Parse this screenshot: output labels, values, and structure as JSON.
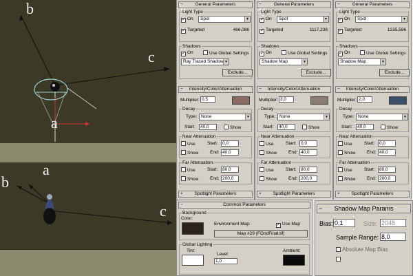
{
  "viewport_top": {
    "label_b": "b",
    "label_c": "c",
    "label_a": "a"
  },
  "viewport_bottom": {
    "label_a": "a",
    "label_b": "b",
    "label_c": "c"
  },
  "panels": [
    {
      "letter": "a",
      "general_title": "General Parameters",
      "light_type_title": "Light Type",
      "on_label": "On",
      "light_type_value": "Spot",
      "targeted_label": "Targeted",
      "target_distance": "466,086",
      "shadows_title": "Shadows",
      "use_global_label": "Use Global Settings",
      "shadow_type": "Ray Traced Shadows",
      "exclude_label": "Exclude...",
      "ica_title": "Intensity/Color/Attenuation",
      "multiplier_label": "Multiplier:",
      "multiplier": "0,5",
      "color": "#8b6b62",
      "decay_title": "Decay",
      "type_label": "Type:",
      "decay_type": "None",
      "start_label": "Start:",
      "decay_start": "40,0",
      "show_label": "Show",
      "near_title": "Near Attenuation",
      "use_label": "Use",
      "near_start": "0,0",
      "end_label": "End:",
      "near_end": "40,0",
      "far_title": "Far Attenuation",
      "far_start": "80,0",
      "far_end": "200,0",
      "spotlight_title": "Spotlight Parameters"
    },
    {
      "letter": "b",
      "general_title": "General Parameters",
      "light_type_title": "Light Type",
      "on_label": "On",
      "light_type_value": "Spot",
      "targeted_label": "Targeted",
      "target_distance": "1117,238",
      "shadows_title": "Shadows",
      "use_global_label": "Use Global Settings",
      "shadow_type": "Shadow Map",
      "exclude_label": "Exclude...",
      "ica_title": "Intensity/Color/Attenuation",
      "multiplier_label": "Multiplier:",
      "multiplier": "3,0",
      "color": "#8b7c70",
      "decay_title": "Decay",
      "type_label": "Type:",
      "decay_type": "None",
      "start_label": "Start:",
      "decay_start": "40,0",
      "show_label": "Show",
      "near_title": "Near Attenuation",
      "use_label": "Use",
      "near_start": "0,0",
      "end_label": "End:",
      "near_end": "40,0",
      "far_title": "Far Attenuation",
      "far_start": "80,0",
      "far_end": "200,0",
      "spotlight_title": "Spotlight Parameters"
    },
    {
      "letter": "c",
      "general_title": "General Parameters",
      "light_type_title": "Light Type",
      "on_label": "On",
      "light_type_value": "Spot",
      "targeted_label": "Targeted",
      "target_distance": "1235,596",
      "shadows_title": "Shadows",
      "use_global_label": "Use Global Settings",
      "shadow_type": "Shadow Map",
      "exclude_label": "Exclude...",
      "ica_title": "Intensity/Color/Attenuation",
      "multiplier_label": "Multiplier:",
      "multiplier": "2,0",
      "color": "#3a5068",
      "decay_title": "Decay",
      "type_label": "Type:",
      "decay_type": "None",
      "start_label": "Start:",
      "decay_start": "40,0",
      "show_label": "Show",
      "near_title": "Near Attenuation",
      "use_label": "Use",
      "near_start": "0,0",
      "end_label": "End:",
      "near_end": "40,0",
      "far_title": "Far Attenuation",
      "far_start": "80,0",
      "far_end": "200,0",
      "spotlight_title": "Spotlight Parameters"
    }
  ],
  "common": {
    "title": "Common Parameters",
    "background_title": "Background",
    "color_label": "Color:",
    "bg_color": "#2c221e",
    "env_map_label": "Environment Map:",
    "use_map_label": "Use Map",
    "map_button": "Map #29 (FOndFinal.tif)",
    "global_lighting_title": "Global Lighting",
    "tint_label": "Tint:",
    "level_label": "Level:",
    "level": "1,0",
    "ambient_label": "Ambient:",
    "tint_color": "#ffffff",
    "ambient_color": "#0a0a0a"
  },
  "shadow_map": {
    "title": "Shadow Map Params",
    "bias_label": "Bias:",
    "bias": "0,1",
    "size_label": "Size:",
    "size": "2048",
    "sample_range_label": "Sample Range:",
    "sample_range": "8,0",
    "abs_bias_label": "Absolute Map Bias"
  }
}
